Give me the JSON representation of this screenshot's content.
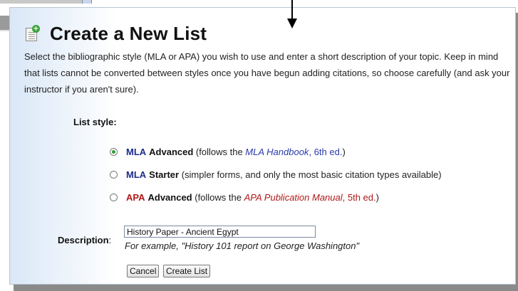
{
  "dialog": {
    "title": "Create a New List",
    "intro": "Select the bibliographic style (MLA or APA) you wish to use and enter a short description of your topic. Keep in mind that lists cannot be converted between styles once you have begun adding citations, so choose carefully (and ask your instructor if you aren't sure).",
    "icon": "new-list-icon"
  },
  "list_style": {
    "label": "List style:",
    "selected": "MLA Advanced",
    "options": [
      {
        "prefix": "MLA",
        "name": "Advanced",
        "detail_before": " (follows the ",
        "publication": "MLA Handbook",
        "detail_mid": ", ",
        "edition": "6th ed.",
        "detail_after": ")"
      },
      {
        "prefix": "MLA",
        "name": "Starter",
        "detail": " (simpler forms, and only the most basic citation types available)"
      },
      {
        "prefix": "APA",
        "name": "Advanced",
        "detail_before": " (follows the ",
        "publication": "APA Publication Manual",
        "detail_mid": ", ",
        "edition": "5th ed.",
        "detail_after": ")"
      }
    ]
  },
  "description": {
    "label": "Description",
    "colon": ":",
    "value": "History Paper - Ancient Egypt",
    "example": "For example, \"History 101 report on George Washington\""
  },
  "buttons": {
    "cancel": "Cancel",
    "create": "Create List"
  },
  "colors": {
    "accent_blue": "#1a2a8c",
    "accent_red": "#b01818",
    "radio_selected": "#2e9a2e"
  }
}
